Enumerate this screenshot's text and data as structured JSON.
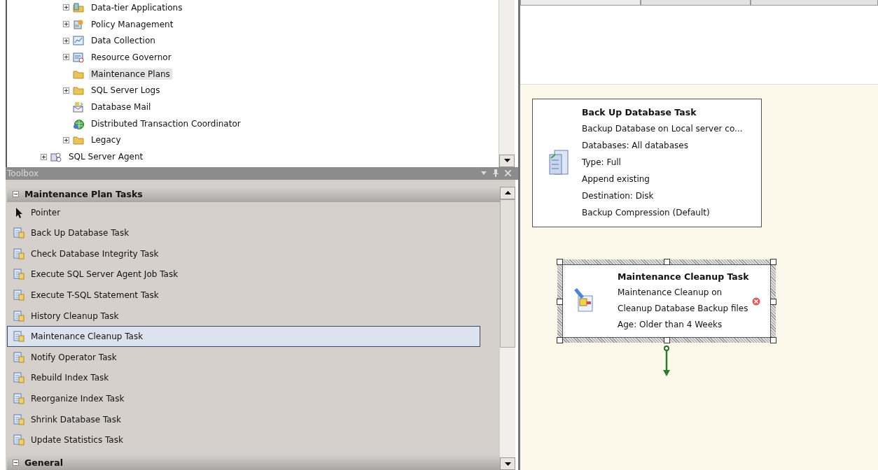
{
  "object_explorer": {
    "nested_items": [
      {
        "label": "Data-tier Applications",
        "kind": "datatier",
        "expandable": true,
        "selected": false
      },
      {
        "label": "Policy Management",
        "kind": "policy",
        "expandable": true,
        "selected": false
      },
      {
        "label": "Data Collection",
        "kind": "collection",
        "expandable": true,
        "selected": false
      },
      {
        "label": "Resource Governor",
        "kind": "governor",
        "expandable": true,
        "selected": false
      },
      {
        "label": "Maintenance Plans",
        "kind": "folder",
        "expandable": false,
        "selected": true
      },
      {
        "label": "SQL Server Logs",
        "kind": "folder",
        "expandable": true,
        "selected": false
      },
      {
        "label": "Database Mail",
        "kind": "mail",
        "expandable": false,
        "selected": false
      },
      {
        "label": "Distributed Transaction Coordinator",
        "kind": "dtc",
        "expandable": false,
        "selected": false
      },
      {
        "label": "Legacy",
        "kind": "folder",
        "expandable": true,
        "selected": false
      }
    ],
    "items": [
      {
        "label": "SQL Server Agent",
        "kind": "agent",
        "expandable": true,
        "selected": false
      }
    ]
  },
  "toolbox": {
    "title": "Toolbox",
    "sections": [
      {
        "label": "Maintenance Plan Tasks",
        "expanded": true,
        "items": [
          {
            "label": "Pointer",
            "kind": "pointer",
            "selected": false
          },
          {
            "label": "Back Up Database Task",
            "kind": "task",
            "selected": false
          },
          {
            "label": "Check Database Integrity Task",
            "kind": "task",
            "selected": false
          },
          {
            "label": "Execute SQL Server Agent Job Task",
            "kind": "task",
            "selected": false
          },
          {
            "label": "Execute T-SQL Statement Task",
            "kind": "task",
            "selected": false
          },
          {
            "label": "History Cleanup Task",
            "kind": "task",
            "selected": false
          },
          {
            "label": "Maintenance Cleanup Task",
            "kind": "task",
            "selected": true
          },
          {
            "label": "Notify Operator Task",
            "kind": "task",
            "selected": false
          },
          {
            "label": "Rebuild Index Task",
            "kind": "task",
            "selected": false
          },
          {
            "label": "Reorganize Index Task",
            "kind": "task",
            "selected": false
          },
          {
            "label": "Shrink Database Task",
            "kind": "task",
            "selected": false
          },
          {
            "label": "Update Statistics Task",
            "kind": "task",
            "selected": false
          }
        ]
      },
      {
        "label": "General",
        "expanded": true
      }
    ]
  },
  "designer": {
    "tasks": [
      {
        "title": "Back Up Database Task",
        "lines": [
          "Backup Database on Local server co...",
          "Databases: All databases",
          "Type: Full",
          "Append existing",
          "Destination: Disk",
          "Backup Compression (Default)"
        ],
        "selected": false,
        "error": false
      },
      {
        "title": "Maintenance Cleanup Task",
        "lines": [
          "Maintenance Cleanup on",
          "Cleanup Database Backup files",
          "Age: Older than 4 Weeks"
        ],
        "selected": true,
        "error": true
      }
    ]
  }
}
